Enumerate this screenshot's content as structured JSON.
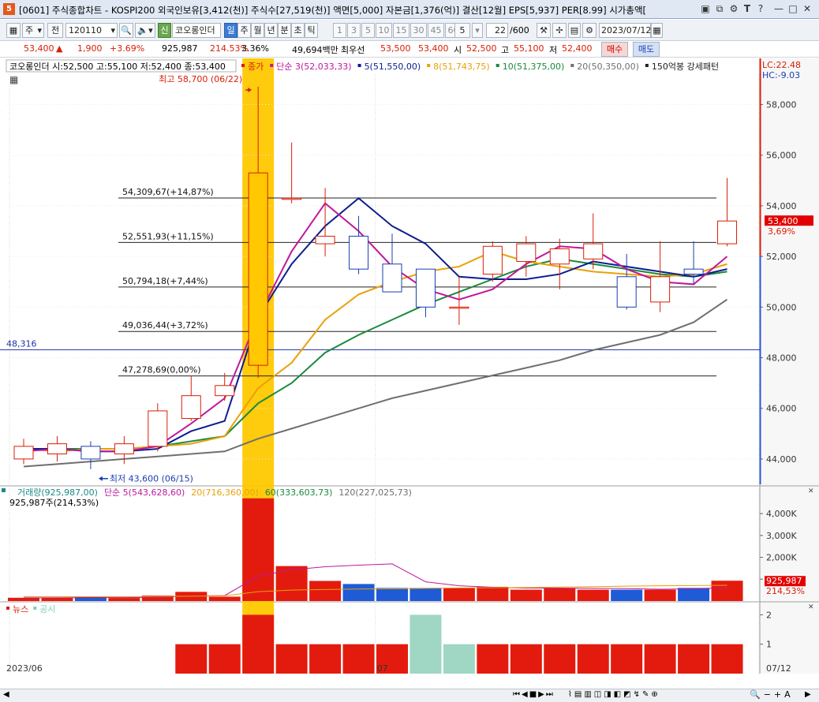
{
  "window": {
    "number": "5",
    "title": "[0601] 주식종합차트 - KOSPI200 외국인보유[3,412(천)] 주식수[27,519(천)] 액면[5,000] 자본금[1,376(억)] 결산[12월] EPS[5,937] PER[8.99] 시가총액["
  },
  "toolbar": {
    "type": "주",
    "scope": "전",
    "code": "120110",
    "badge": "신",
    "name": "코오롱인더",
    "periods": [
      "일",
      "주",
      "월",
      "년",
      "분",
      "초",
      "틱"
    ],
    "active_period": "일",
    "intervals": [
      "1",
      "3",
      "5",
      "10",
      "15",
      "30",
      "45",
      "60"
    ],
    "interval_value": "5",
    "count": "22",
    "count_max": "/600",
    "date": "2023/07/12"
  },
  "price": {
    "current": "53,400",
    "arrow": "▲",
    "change": "1,900",
    "pct": "+3.69%",
    "volume": "925,987",
    "vol_pct": "214.53%",
    "turnover": "3.36%",
    "amount": "49,694백만",
    "best_label": "최우선",
    "ask": "53,500",
    "bid": "53,400",
    "open_label": "시",
    "open": "52,500",
    "high_label": "고",
    "high": "55,100",
    "low_label": "저",
    "low": "52,400",
    "buy": "매수",
    "sell": "매도"
  },
  "price_panel": {
    "header": "코오롱인더 시:52,500 고:55,100 저:52,400 종:53,400",
    "legend": [
      {
        "text": "종가",
        "color": "#d81e06"
      },
      {
        "text": "단순 3(52,033,33)",
        "color": "#c0189c"
      },
      {
        "text": "5(51,550,00)",
        "color": "#0b1e8f"
      },
      {
        "text": "8(51,743,75)",
        "color": "#e8a10a"
      },
      {
        "text": "10(51,375,00)",
        "color": "#1a8a3c"
      },
      {
        "text": "20(50,350,00)",
        "color": "#6f6f6f"
      },
      {
        "text": "150억봉 강세패턴",
        "color": "#222222"
      }
    ],
    "lc": "LC:22.48",
    "hc": "HC:-9.03",
    "y_ticks": [
      "58,000",
      "56,000",
      "54,000",
      "52,000",
      "50,000",
      "48,000",
      "46,000",
      "44,000"
    ],
    "high_note": "최고 58,700 (06/22)",
    "low_note": "최저 43,600 (06/15)",
    "ref_line": "48,316",
    "fib_lines": [
      "54,309,67(+14,87%)",
      "52,551,93(+11,15%)",
      "50,794,18(+7,44%)",
      "49,036,44(+3,72%)",
      "47,278,69(0,00%)"
    ],
    "price_tag": "53,400",
    "pct_tag": "3,69%"
  },
  "volume_panel": {
    "legend": [
      {
        "text": "거래량(925,987,00)",
        "color": "#1a8a8a"
      },
      {
        "text": "단순 5(543,628,60)",
        "color": "#c0189c"
      },
      {
        "text": "20(716,360,00)",
        "color": "#e8a10a"
      },
      {
        "text": "60(333,603,73)",
        "color": "#1a8a3c"
      },
      {
        "text": "120(227,025,73)",
        "color": "#6f6f6f"
      }
    ],
    "sub": "925,987주(214,53%)",
    "y_ticks": [
      "4,000K",
      "3,000K",
      "2,000K",
      "1,000K"
    ],
    "tag": "925,987",
    "tag_pct": "214,53%"
  },
  "news_panel": {
    "legend": [
      {
        "text": "뉴스",
        "color": "#d81e06"
      },
      {
        "text": "공시",
        "color": "#7fd0b8"
      }
    ],
    "y_ticks": [
      "2",
      "1"
    ]
  },
  "x_axis": {
    "start": "2023/06",
    "mid": "07",
    "end": "07/12"
  },
  "chart_data": {
    "type": "candlestick",
    "dates": [
      "06/13",
      "06/14",
      "06/15",
      "06/16",
      "06/19",
      "06/20",
      "06/21",
      "06/22",
      "06/23",
      "06/26",
      "06/27",
      "06/28",
      "06/29",
      "06/30",
      "07/03",
      "07/04",
      "07/05",
      "07/06",
      "07/07",
      "07/10",
      "07/11",
      "07/12"
    ],
    "open": [
      44000,
      44200,
      44500,
      44200,
      44500,
      45600,
      46500,
      47700,
      54300,
      52500,
      52800,
      51700,
      51500,
      50000,
      51300,
      51800,
      51700,
      51900,
      51200,
      50200,
      51500,
      52500
    ],
    "close": [
      44500,
      44600,
      44000,
      44600,
      45900,
      46500,
      46900,
      55300,
      54300,
      52800,
      51500,
      50600,
      50000,
      50000,
      52400,
      52500,
      52300,
      52500,
      50000,
      51200,
      51300,
      53400
    ],
    "high": [
      44800,
      44900,
      44700,
      44900,
      46200,
      47300,
      47400,
      58700,
      56500,
      54700,
      53600,
      52900,
      51500,
      51200,
      52600,
      52800,
      52700,
      53700,
      52100,
      52600,
      52600,
      55100
    ],
    "low": [
      43800,
      43900,
      43600,
      43800,
      44300,
      45500,
      46300,
      47200,
      54100,
      52000,
      51300,
      50600,
      49600,
      49300,
      51000,
      51200,
      50700,
      51500,
      49900,
      49800,
      50900,
      52400
    ],
    "ma3": [
      44300,
      44400,
      44300,
      44300,
      44500,
      45400,
      46400,
      49600,
      52200,
      54100,
      53000,
      51600,
      50700,
      50300,
      50700,
      51700,
      52400,
      52300,
      51500,
      51000,
      50900,
      52000
    ],
    "ma5": [
      44400,
      44400,
      44300,
      44300,
      44400,
      45100,
      45500,
      49600,
      51700,
      53200,
      54300,
      53200,
      52500,
      51200,
      51100,
      51100,
      51300,
      51800,
      51600,
      51400,
      51200,
      51500
    ],
    "ma8": [
      44400,
      44300,
      44400,
      44400,
      44500,
      44600,
      44900,
      46800,
      47800,
      49500,
      50500,
      51000,
      51400,
      51600,
      52200,
      51800,
      51600,
      51400,
      51300,
      51200,
      51300,
      51700
    ],
    "ma10": [
      44400,
      44400,
      44400,
      44400,
      44500,
      44700,
      44900,
      46200,
      47000,
      48200,
      48900,
      49500,
      50100,
      50600,
      51100,
      51600,
      51900,
      51700,
      51500,
      51300,
      51200,
      51400
    ],
    "ma20": [
      43700,
      43800,
      43900,
      44000,
      44100,
      44200,
      44300,
      44800,
      45200,
      45600,
      46000,
      46400,
      46700,
      47000,
      47300,
      47600,
      47900,
      48300,
      48600,
      48900,
      49400,
      50300
    ],
    "volume": [
      0.15,
      0.15,
      0.18,
      0.14,
      0.25,
      0.42,
      0.2,
      4.7,
      1.6,
      0.92,
      0.78,
      0.6,
      0.6,
      0.6,
      0.65,
      0.52,
      0.6,
      0.52,
      0.52,
      0.52,
      0.6,
      0.93
    ],
    "vol_ma5": [
      0.15,
      0.15,
      0.16,
      0.16,
      0.17,
      0.23,
      0.25,
      1.14,
      1.43,
      1.57,
      1.64,
      1.7,
      0.88,
      0.7,
      0.63,
      0.59,
      0.59,
      0.58,
      0.57,
      0.54,
      0.56,
      0.61
    ],
    "vol_ma20": [
      0.2,
      0.2,
      0.2,
      0.2,
      0.21,
      0.22,
      0.24,
      0.43,
      0.5,
      0.53,
      0.55,
      0.56,
      0.58,
      0.6,
      0.61,
      0.62,
      0.64,
      0.66,
      0.68,
      0.7,
      0.71,
      0.72
    ],
    "news": [
      0,
      0,
      0,
      0,
      0,
      1,
      1,
      2,
      1,
      1,
      1,
      1,
      2,
      1,
      1,
      1,
      1,
      1,
      1,
      1,
      1,
      1
    ],
    "news_kind": [
      "",
      "",
      "",
      "",
      "",
      "n",
      "n",
      "n",
      "n",
      "n",
      "n",
      "n",
      "d",
      "d",
      "n",
      "n",
      "n",
      "n",
      "n",
      "n",
      "n",
      "n"
    ],
    "fib": [
      54309.67,
      52551.93,
      50794.18,
      49036.44,
      47278.69
    ],
    "ref": 48316,
    "ylim": [
      43000,
      59200
    ],
    "vol_ylim": [
      0,
      4.8
    ],
    "news_ylim": [
      0,
      2.2
    ]
  }
}
